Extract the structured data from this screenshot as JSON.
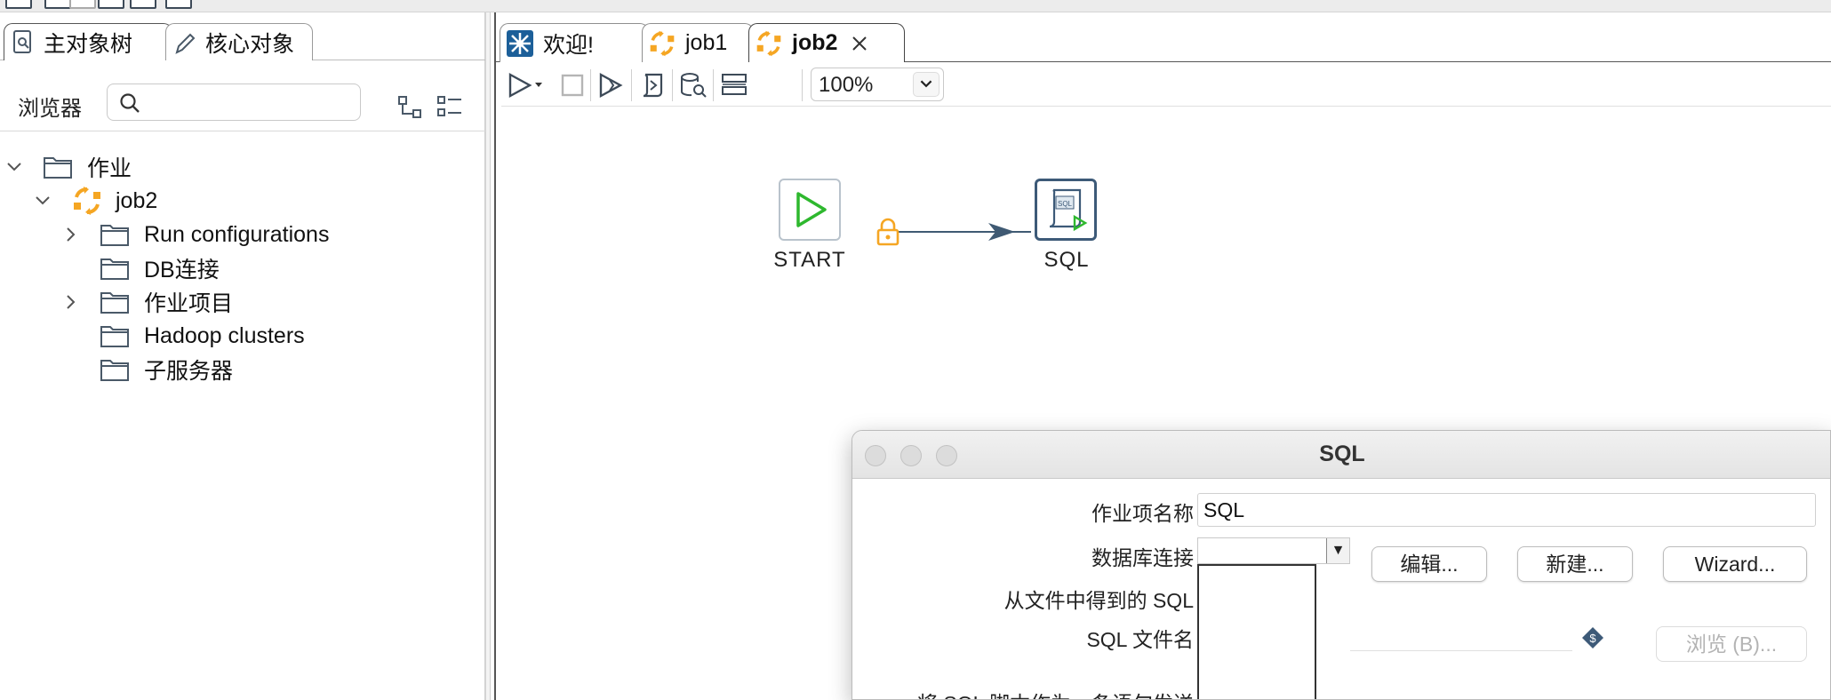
{
  "left_panel": {
    "tabs": [
      {
        "label": "主对象树",
        "icon": "object-tree-icon"
      },
      {
        "label": "核心对象",
        "icon": "pencil-icon"
      }
    ],
    "browser_label": "浏览器",
    "search_placeholder": "",
    "tree": [
      {
        "label": "作业",
        "expanded": true,
        "icon": "folder-icon"
      },
      {
        "label": "job2",
        "expanded": true,
        "icon": "job-icon"
      },
      {
        "label": "Run configurations",
        "expandable": true,
        "icon": "folder-icon"
      },
      {
        "label": "DB连接",
        "expandable": false,
        "icon": "folder-icon"
      },
      {
        "label": "作业项目",
        "expandable": true,
        "icon": "folder-icon"
      },
      {
        "label": "Hadoop clusters",
        "expandable": false,
        "icon": "folder-icon"
      },
      {
        "label": "子服务器",
        "expandable": false,
        "icon": "folder-icon"
      }
    ]
  },
  "editor": {
    "tabs": [
      {
        "label": "欢迎!",
        "icon": "spoon-icon",
        "active": false
      },
      {
        "label": "job1",
        "icon": "job-icon",
        "active": false
      },
      {
        "label": "job2",
        "icon": "job-icon",
        "active": true
      }
    ],
    "zoom": "100%",
    "nodes": [
      {
        "label": "START",
        "icon": "start-play-icon"
      },
      {
        "label": "SQL",
        "icon": "sql-script-icon"
      }
    ],
    "hop_icon": "lock-icon"
  },
  "dialog": {
    "title": "SQL",
    "fields": {
      "job_entry_name_label": "作业项名称",
      "job_entry_name_value": "SQL",
      "db_connection_label": "数据库连接",
      "sql_from_file_label": "从文件中得到的 SQL",
      "sql_filename_label": "SQL 文件名",
      "send_as_single_label": "将 SQL 脚本作为一条语句发送"
    },
    "buttons": {
      "edit": "编辑...",
      "new": "新建...",
      "wizard": "Wizard...",
      "browse": "浏览 (B)..."
    }
  },
  "colors": {
    "accent_orange": "#f5a623",
    "start_green": "#2eb82e",
    "hop_blue": "#3f5a73",
    "node_border": "#3d5a78"
  }
}
